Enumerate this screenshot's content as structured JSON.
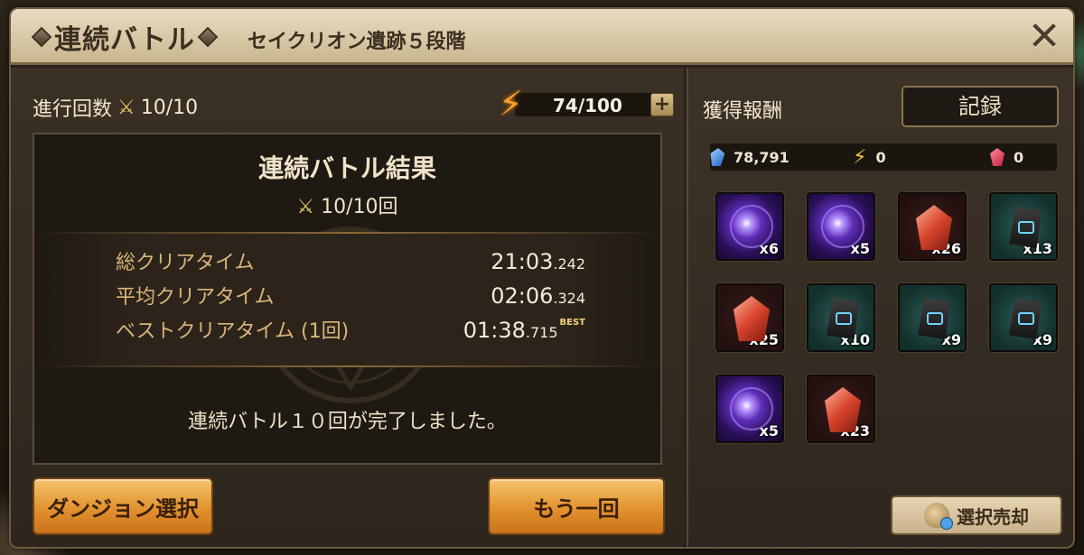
{
  "header": {
    "title": "連続バトル",
    "subtitle": "セイクリオン遺跡５段階"
  },
  "left": {
    "progress_label": "進行回数",
    "progress_value": "10/10",
    "energy": "74/100",
    "energy_plus": "+",
    "result": {
      "title": "連続バトル結果",
      "count": "10/10回",
      "stats": [
        {
          "label": "総クリアタイム",
          "main": "21:03",
          "ms": ".242",
          "best": ""
        },
        {
          "label": "平均クリアタイム",
          "main": "02:06",
          "ms": ".324",
          "best": ""
        },
        {
          "label": "ベストクリアタイム (1回)",
          "main": "01:38",
          "ms": ".715",
          "best": "BEST"
        }
      ],
      "message": "連続バトル１０回が完了しました。"
    },
    "buttons": {
      "dungeon_select": "ダンジョン選択",
      "once_more": "もう一回"
    }
  },
  "right": {
    "title": "獲得報酬",
    "records": "記録",
    "currency": {
      "crystal": "78,791",
      "energy": "0",
      "red_gem": "0"
    },
    "items": [
      {
        "type": "essence",
        "qty": "x6"
      },
      {
        "type": "essence",
        "qty": "x5"
      },
      {
        "type": "crystal",
        "qty": "x26"
      },
      {
        "type": "rune",
        "qty": "x13"
      },
      {
        "type": "crystal",
        "qty": "x25"
      },
      {
        "type": "rune",
        "qty": "x10"
      },
      {
        "type": "rune",
        "qty": "x9"
      },
      {
        "type": "rune",
        "qty": "x9"
      },
      {
        "type": "essence",
        "qty": "x5"
      },
      {
        "type": "crystal",
        "qty": "x23"
      }
    ],
    "sell_button": "選択売却"
  }
}
